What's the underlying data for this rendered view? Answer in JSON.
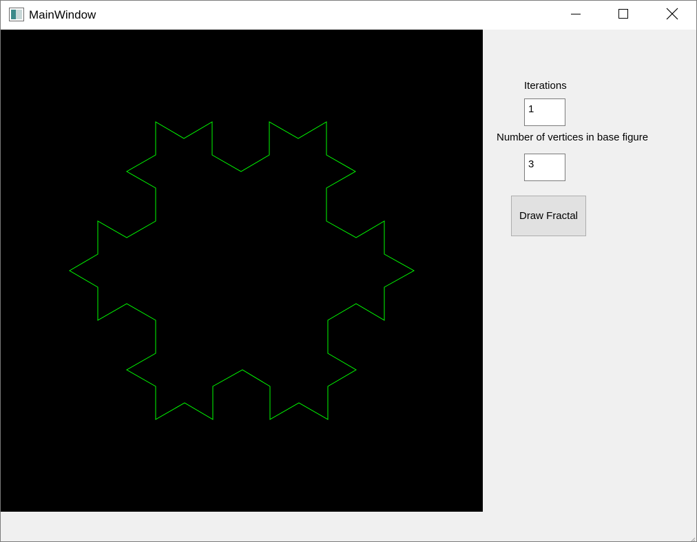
{
  "window": {
    "title": "MainWindow",
    "controls": {
      "minimize_icon": "minimize-icon",
      "maximize_icon": "maximize-icon",
      "close_icon": "close-icon"
    }
  },
  "canvas": {
    "background": "#000000",
    "stroke_color": "#00ff00"
  },
  "controls": {
    "iterations_label": "Iterations",
    "iterations_value": "1",
    "vertices_label": "Number of vertices in base figure",
    "vertices_value": "3",
    "draw_button_label": "Draw Fractal"
  },
  "colors": {
    "window_bg": "#f0f0f0",
    "titlebar_bg": "#ffffff",
    "button_bg": "#e1e1e1",
    "fractal_green": "#00ff00"
  }
}
